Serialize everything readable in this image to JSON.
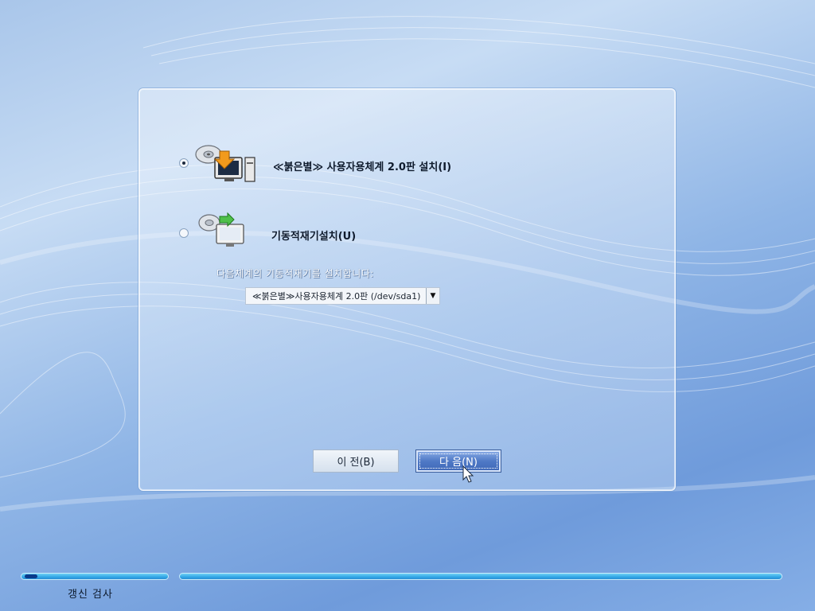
{
  "options": [
    {
      "label": "≪붉은별≫ 사용자용체계 2.0판 설치(I)",
      "checked": true,
      "icon": "cd-install-monitor-icon"
    },
    {
      "label": "기동적재기설치(U)",
      "checked": false,
      "icon": "cd-bootloader-monitor-icon"
    }
  ],
  "bootloader": {
    "hint": "다음체계의 기동적재기를 설치합니다:",
    "selected": "≪붉은별≫사용자용체계 2.0판 (/dev/sda1)"
  },
  "buttons": {
    "prev_label": "이 전(B)",
    "next_label": "다 음(N)"
  },
  "status": {
    "text": "갱신 검사"
  },
  "colors": {
    "accent": "#4f79c6",
    "progress": "#32a7e6"
  }
}
